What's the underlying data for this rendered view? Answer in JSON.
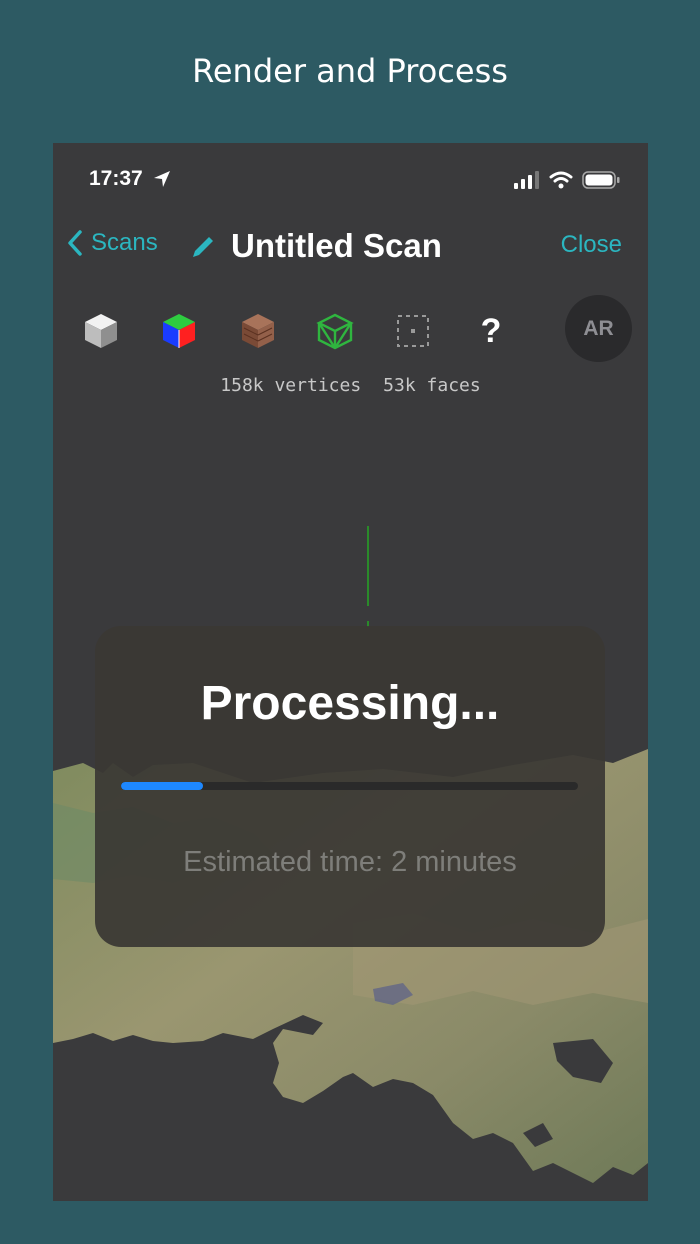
{
  "caption": "Render and Process",
  "status_bar": {
    "time": "17:37"
  },
  "nav": {
    "back_label": "Scans",
    "title": "Untitled Scan",
    "close_label": "Close"
  },
  "toolbar": {
    "tools": [
      "solid-cube-icon",
      "rgb-cube-icon",
      "texture-cube-icon",
      "wireframe-cube-icon",
      "bounding-box-icon",
      "help-icon"
    ],
    "help_glyph": "?",
    "ar_label": "AR"
  },
  "stats": {
    "vertices": "158k vertices",
    "faces": "53k faces"
  },
  "dialog": {
    "heading": "Processing...",
    "progress_fraction": 0.18,
    "estimate": "Estimated time: 2 minutes"
  },
  "colors": {
    "accent": "#2bb6c0",
    "progress": "#1e88ff",
    "background": "#2d5a63"
  }
}
